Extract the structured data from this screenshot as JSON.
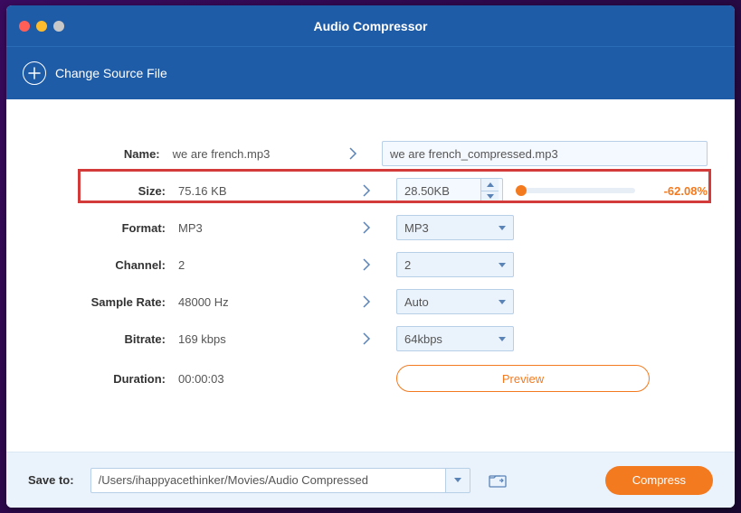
{
  "window": {
    "title": "Audio Compressor"
  },
  "toolbar": {
    "change_source": "Change Source File"
  },
  "rows": {
    "name": {
      "label": "Name:",
      "source": "we are french.mp3",
      "target": "we are french_compressed.mp3"
    },
    "size": {
      "label": "Size:",
      "source": "75.16 KB",
      "target": "28.50KB",
      "percent": "-62.08%"
    },
    "format": {
      "label": "Format:",
      "source": "MP3",
      "target": "MP3"
    },
    "channel": {
      "label": "Channel:",
      "source": "2",
      "target": "2"
    },
    "sample_rate": {
      "label": "Sample Rate:",
      "source": "48000 Hz",
      "target": "Auto"
    },
    "bitrate": {
      "label": "Bitrate:",
      "source": "169 kbps",
      "target": "64kbps"
    },
    "duration": {
      "label": "Duration:",
      "source": "00:00:03"
    }
  },
  "preview_label": "Preview",
  "bottom": {
    "save_label": "Save to:",
    "path": "/Users/ihappyacethinker/Movies/Audio Compressed",
    "compress_label": "Compress"
  }
}
